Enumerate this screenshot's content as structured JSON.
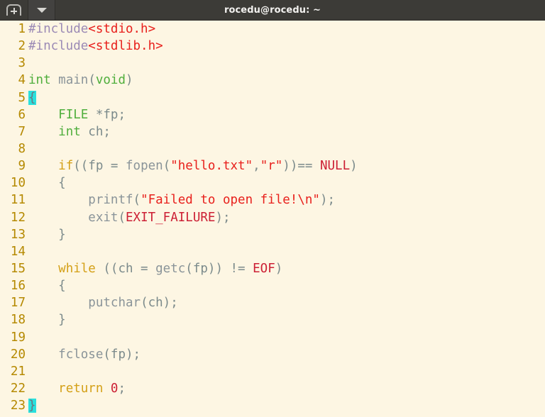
{
  "window": {
    "title": "rocedu@rocedu: ~",
    "titlebar_bg": "#3c3b37",
    "titlebar_fg": "#f2f1ef"
  },
  "titlebar": {
    "new_tab_button": {
      "name": "new-tab-button",
      "label": "+"
    },
    "menu_button": {
      "name": "tab-menu-button",
      "label": "▼"
    }
  },
  "editor": {
    "background": "#fdf6e3",
    "gutter_color": "#b58900",
    "default_text_color": "#6c7680",
    "match_highlight_color": "#29e0dd",
    "language": "c",
    "total_lines": 23,
    "lines": [
      {
        "n": "1",
        "tokens": [
          {
            "t": "#include",
            "c": "t-pre"
          },
          {
            "t": "<stdio.h>",
            "c": "t-header"
          }
        ]
      },
      {
        "n": "2",
        "tokens": [
          {
            "t": "#include",
            "c": "t-pre"
          },
          {
            "t": "<stdlib.h>",
            "c": "t-header"
          }
        ]
      },
      {
        "n": "3",
        "tokens": []
      },
      {
        "n": "4",
        "tokens": [
          {
            "t": "int",
            "c": "t-type"
          },
          {
            "t": " ",
            "c": "t-plain"
          },
          {
            "t": "main",
            "c": "t-ident"
          },
          {
            "t": "(",
            "c": "t-plain"
          },
          {
            "t": "void",
            "c": "t-type"
          },
          {
            "t": ")",
            "c": "t-plain"
          }
        ]
      },
      {
        "n": "5",
        "tokens": [
          {
            "t": "{",
            "c": "brace-hl"
          }
        ]
      },
      {
        "n": "6",
        "tokens": [
          {
            "t": "    ",
            "c": "t-plain"
          },
          {
            "t": "FILE",
            "c": "t-type"
          },
          {
            "t": " *fp;",
            "c": "t-plain"
          }
        ]
      },
      {
        "n": "7",
        "tokens": [
          {
            "t": "    ",
            "c": "t-plain"
          },
          {
            "t": "int",
            "c": "t-type"
          },
          {
            "t": " ch;",
            "c": "t-plain"
          }
        ]
      },
      {
        "n": "8",
        "tokens": []
      },
      {
        "n": "9",
        "tokens": [
          {
            "t": "    ",
            "c": "t-plain"
          },
          {
            "t": "if",
            "c": "t-kw"
          },
          {
            "t": "((fp = ",
            "c": "t-plain"
          },
          {
            "t": "fopen",
            "c": "t-fn"
          },
          {
            "t": "(",
            "c": "t-plain"
          },
          {
            "t": "\"hello.txt\"",
            "c": "t-string"
          },
          {
            "t": ",",
            "c": "t-plain"
          },
          {
            "t": "\"r\"",
            "c": "t-string"
          },
          {
            "t": "))== ",
            "c": "t-plain"
          },
          {
            "t": "NULL",
            "c": "t-const"
          },
          {
            "t": ")",
            "c": "t-plain"
          }
        ]
      },
      {
        "n": "10",
        "tokens": [
          {
            "t": "    {",
            "c": "t-plain"
          }
        ]
      },
      {
        "n": "11",
        "tokens": [
          {
            "t": "        ",
            "c": "t-plain"
          },
          {
            "t": "printf",
            "c": "t-fn"
          },
          {
            "t": "(",
            "c": "t-plain"
          },
          {
            "t": "\"Failed to open file!\\n\"",
            "c": "t-string"
          },
          {
            "t": ");",
            "c": "t-plain"
          }
        ]
      },
      {
        "n": "12",
        "tokens": [
          {
            "t": "        ",
            "c": "t-plain"
          },
          {
            "t": "exit",
            "c": "t-fn"
          },
          {
            "t": "(",
            "c": "t-plain"
          },
          {
            "t": "EXIT_FAILURE",
            "c": "t-const"
          },
          {
            "t": ");",
            "c": "t-plain"
          }
        ]
      },
      {
        "n": "13",
        "tokens": [
          {
            "t": "    }",
            "c": "t-plain"
          }
        ]
      },
      {
        "n": "14",
        "tokens": []
      },
      {
        "n": "15",
        "tokens": [
          {
            "t": "    ",
            "c": "t-plain"
          },
          {
            "t": "while",
            "c": "t-kw"
          },
          {
            "t": " ((ch = ",
            "c": "t-plain"
          },
          {
            "t": "getc",
            "c": "t-fn"
          },
          {
            "t": "(fp)) != ",
            "c": "t-plain"
          },
          {
            "t": "EOF",
            "c": "t-const"
          },
          {
            "t": ")",
            "c": "t-plain"
          }
        ]
      },
      {
        "n": "16",
        "tokens": [
          {
            "t": "    {",
            "c": "t-plain"
          }
        ]
      },
      {
        "n": "17",
        "tokens": [
          {
            "t": "        ",
            "c": "t-plain"
          },
          {
            "t": "putchar",
            "c": "t-fn"
          },
          {
            "t": "(ch);",
            "c": "t-plain"
          }
        ]
      },
      {
        "n": "18",
        "tokens": [
          {
            "t": "    }",
            "c": "t-plain"
          }
        ]
      },
      {
        "n": "19",
        "tokens": []
      },
      {
        "n": "20",
        "tokens": [
          {
            "t": "    ",
            "c": "t-plain"
          },
          {
            "t": "fclose",
            "c": "t-fn"
          },
          {
            "t": "(fp);",
            "c": "t-plain"
          }
        ]
      },
      {
        "n": "21",
        "tokens": []
      },
      {
        "n": "22",
        "tokens": [
          {
            "t": "    ",
            "c": "t-plain"
          },
          {
            "t": "return",
            "c": "t-kw"
          },
          {
            "t": " ",
            "c": "t-plain"
          },
          {
            "t": "0",
            "c": "t-const"
          },
          {
            "t": ";",
            "c": "t-plain"
          }
        ]
      },
      {
        "n": "23",
        "tokens": [
          {
            "t": "}",
            "c": "brace-hl"
          }
        ]
      }
    ]
  }
}
